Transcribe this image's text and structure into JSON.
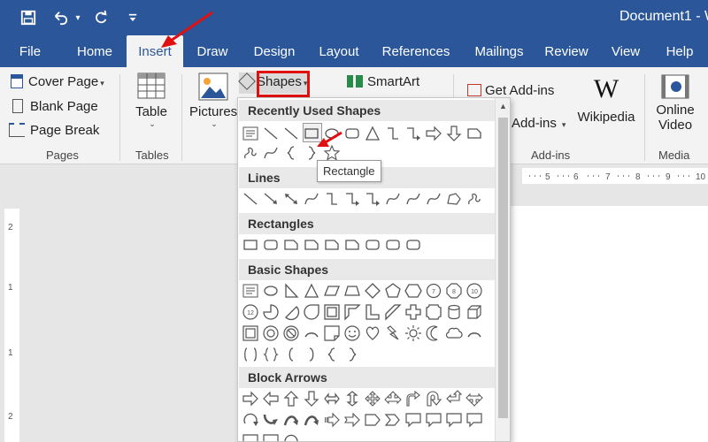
{
  "titlebar": {
    "save_icon": "save-icon",
    "undo_icon": "undo-icon",
    "redo_icon": "redo-icon",
    "customize_icon": "customize-qat-icon",
    "doc_title": "Document1 - W"
  },
  "tabs": [
    "File",
    "Home",
    "Insert",
    "Draw",
    "Design",
    "Layout",
    "References",
    "Mailings",
    "Review",
    "View",
    "Help"
  ],
  "active_tab": "Insert",
  "ribbon": {
    "pages": {
      "cover_page": "Cover Page",
      "blank_page": "Blank Page",
      "page_break": "Page Break",
      "label": "Pages"
    },
    "tables": {
      "table": "Table",
      "label": "Tables"
    },
    "illustrations": {
      "pictures": "Pictures",
      "shapes": "Shapes",
      "smartart": "SmartArt"
    },
    "addins": {
      "get_addins": "Get Add-ins",
      "my_addins": "Add-ins",
      "wikipedia": "Wikipedia",
      "label": "Add-ins"
    },
    "media": {
      "online_video_1": "Online",
      "online_video_2": "Video",
      "label": "Media"
    }
  },
  "gallery": {
    "sections": [
      "Recently Used Shapes",
      "Lines",
      "Rectangles",
      "Basic Shapes",
      "Block Arrows"
    ],
    "tooltip": "Rectangle"
  },
  "colors": {
    "brand": "#2b579a",
    "highlight": "#e01010"
  }
}
